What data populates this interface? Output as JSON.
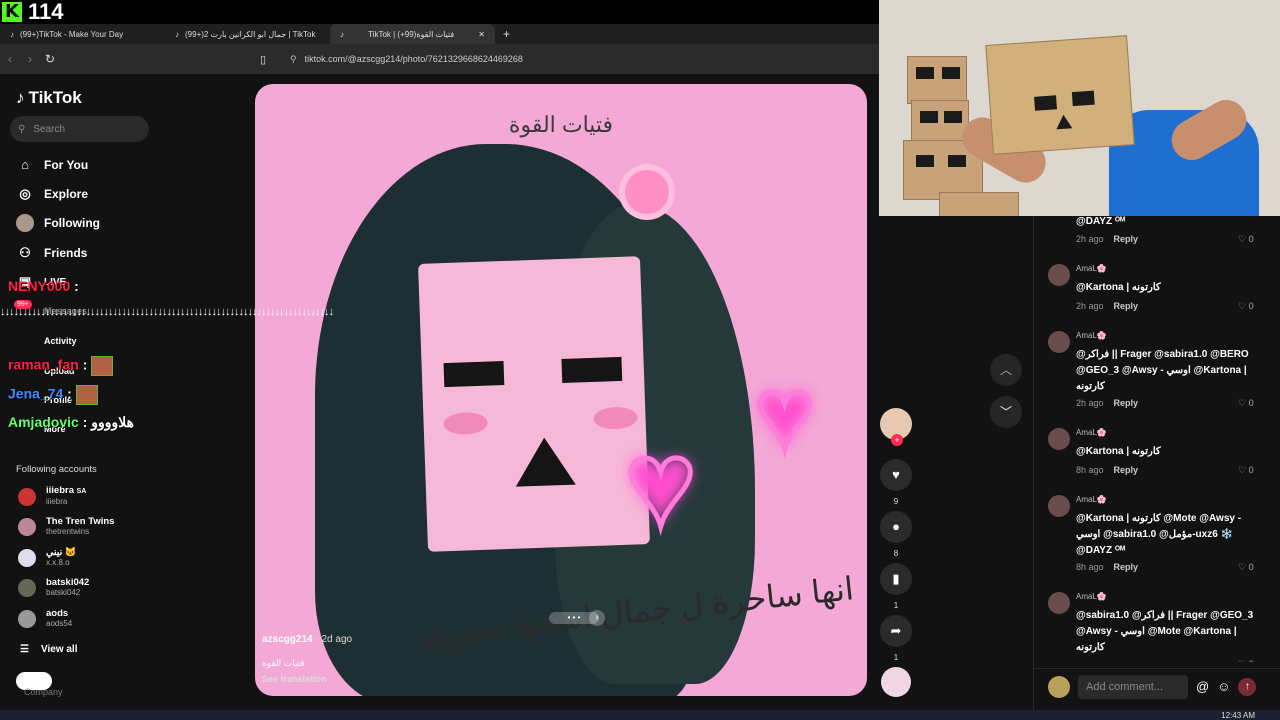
{
  "stream": {
    "viewer_count": "114"
  },
  "tabs": [
    {
      "label": "(99+)TikTok - Make Your Day"
    },
    {
      "label": "(99+)جمال ابو الكراتين بارت 2 | TikTok"
    },
    {
      "label": "TikTok | فتيات القوة(99+)"
    }
  ],
  "address": {
    "url": "tiktok.com/@azscgg214/photo/7621329668624469268"
  },
  "sidebar": {
    "logo": "TikTok",
    "search_placeholder": "Search",
    "nav": [
      "For You",
      "Explore",
      "Following",
      "Friends",
      "LIVE",
      "Messages",
      "Activity",
      "Upload",
      "Profile",
      "More"
    ],
    "badge": "99+",
    "following_title": "Following accounts",
    "accounts": [
      {
        "name": "iiiebra",
        "tag": "SA",
        "handle": "iiiebra"
      },
      {
        "name": "The Tren Twins",
        "handle": "thetrentwins"
      },
      {
        "name": "نيني 🐱",
        "handle": "x.x.8.o"
      },
      {
        "name": "batski042",
        "handle": "batski042"
      },
      {
        "name": "aods",
        "handle": "aods54"
      }
    ],
    "view_all": "View all",
    "company": "Company"
  },
  "chat": [
    {
      "user": "NENY000",
      "msg": ":"
    },
    {
      "user": "raman_fan",
      "msg": ":"
    },
    {
      "user": "Jena_74",
      "msg": ":"
    },
    {
      "user": "Amjadovic",
      "msg": ": هلاوووو"
    }
  ],
  "glitch_text": "↓↓↓↓↓↓↓↓↓↓↓↓↓↓↓↓↓↓↓↓↓↓↓↓↓↓↓↓↓↓↓↓↓↓↓↓↓↓↓↓↓↓↓↓↓↓↓↓↓↓↓↓↓↓↓↓↓↓↓↓↓↓↓↓↓↓↓↓↓↓↓↓↓↓",
  "video": {
    "title_text": "فتيات القوة",
    "caption_text": "انها ساحرة ل جمال اسمها سوري",
    "author": "azscgg214",
    "time": "· 2d ago",
    "description": "فتيات القوة",
    "see_translation": "See translation"
  },
  "actions": {
    "likes": "9",
    "comments": "8",
    "saves": "1",
    "shares": "1"
  },
  "comments": [
    {
      "user": "",
      "text": "@DAYZ ᴼᴹ",
      "time": "2h ago",
      "likes": "0"
    },
    {
      "user": "AmaL🌸",
      "text": "@Kartona | كارتونه",
      "time": "2h ago",
      "likes": "0"
    },
    {
      "user": "AmaL🌸",
      "text": "@فراكر || Frager @sabira1.0 @BERO @GEO_3 @Awsy - اوسي @Kartona | كارتونه",
      "time": "2h ago",
      "likes": "0"
    },
    {
      "user": "AmaL🌸",
      "text": "@Kartona | كارتونه",
      "time": "8h ago",
      "likes": "0"
    },
    {
      "user": "AmaL🌸",
      "text": "@Kartona | كارتونه @Mote @Awsy - اوسي @sabira1.0 @مؤمل-uxz6 ❄️ @DAYZ ᴼᴹ",
      "time": "8h ago",
      "likes": "0"
    },
    {
      "user": "AmaL🌸",
      "text": "@sabira1.0 @فراكر || Frager @GEO_3 @Awsy - اوسي @Mote @Kartona | كارتونه",
      "time": "",
      "likes": "0"
    }
  ],
  "reply_label": "Reply",
  "add_comment_placeholder": "Add comment...",
  "taskbar": {
    "clock": "12:43 AM"
  }
}
